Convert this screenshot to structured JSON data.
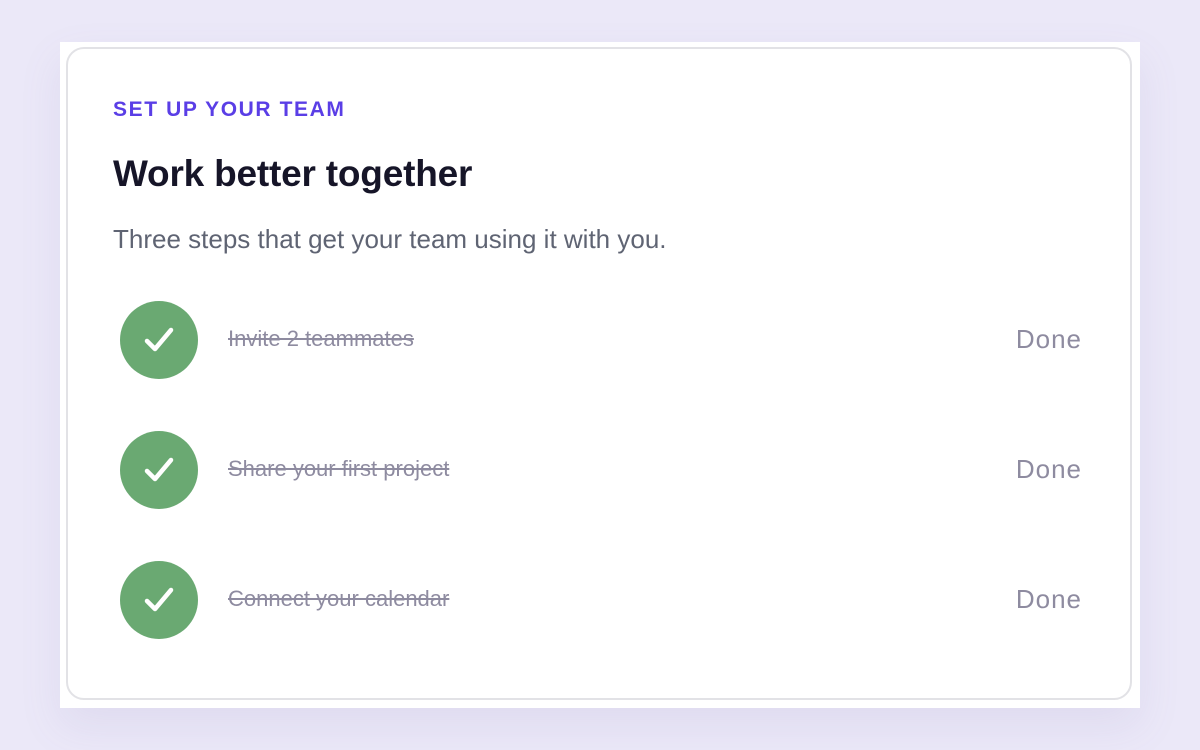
{
  "card": {
    "eyebrow": "SET UP YOUR TEAM",
    "title": "Work better together",
    "subtitle": "Three steps that get your team using it with you."
  },
  "steps": [
    {
      "label": "Invite 2 teammates",
      "status": "Done",
      "completed": true,
      "icon": "check-icon"
    },
    {
      "label": "Share your first project",
      "status": "Done",
      "completed": true,
      "icon": "check-icon"
    },
    {
      "label": "Connect your calendar",
      "status": "Done",
      "completed": true,
      "icon": "check-icon"
    }
  ],
  "colors": {
    "page_background": "#ebe8f8",
    "accent": "#5a3ee6",
    "success": "#6aa972",
    "muted_text": "#8e8ba0"
  }
}
